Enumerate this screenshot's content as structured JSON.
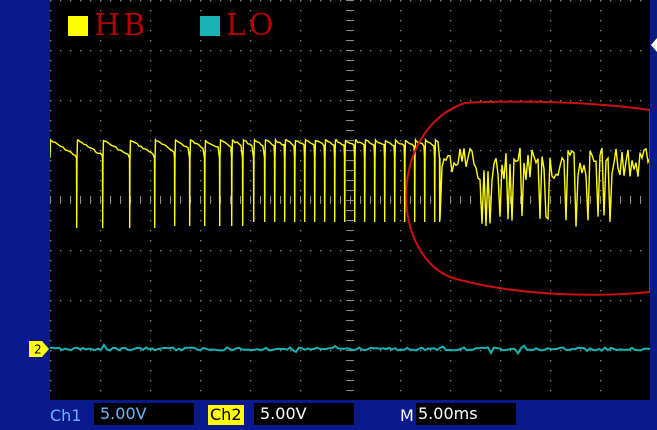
{
  "legend": {
    "items": [
      {
        "label": "HB",
        "color": "#ffff00"
      },
      {
        "label": "LO",
        "color": "#1ab3b3"
      }
    ]
  },
  "channel_marker": {
    "text": "2",
    "color": "#ffff00"
  },
  "status_bar": {
    "ch1_label": "Ch1",
    "ch1_value": "5.00V",
    "ch2_label": "Ch2",
    "ch2_value": "5.00V",
    "m_label": "M",
    "m_value": "5.00ms"
  },
  "colors": {
    "frame_bg": "#0a1a8c",
    "screen_bg": "#000000",
    "grid": "#8a8a8a",
    "trace_hb": "#ffff00",
    "trace_lo": "#1ab3b3",
    "annotation_circle": "#cc1111",
    "status_value_text": "#6bb5ff"
  }
}
